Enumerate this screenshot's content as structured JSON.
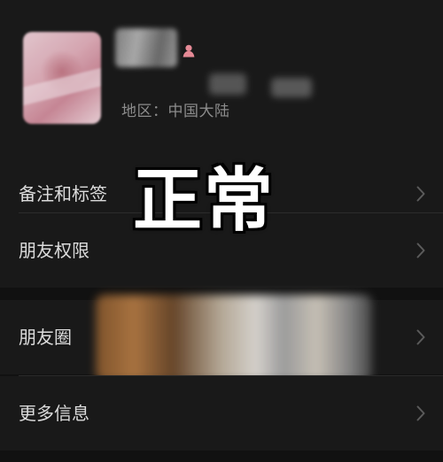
{
  "profile": {
    "region": "地区：中国大陆",
    "avatar_icon": "avatar-image",
    "gender_icon": "female-icon",
    "gender_color": "#e58a96"
  },
  "sections": [
    {
      "label": "备注和标签",
      "icon": "chevron-right-icon"
    },
    {
      "label": "朋友权限",
      "icon": "chevron-right-icon"
    },
    {
      "label": "朋友圈",
      "icon": "chevron-right-icon"
    },
    {
      "label": "更多信息",
      "icon": "chevron-right-icon"
    }
  ],
  "overlay": {
    "text": "正常"
  },
  "colors": {
    "background": "#111111",
    "cell": "#191919",
    "text": "#dcdcdc",
    "muted": "#8c8c8c",
    "chevron": "#5b5b5b"
  }
}
